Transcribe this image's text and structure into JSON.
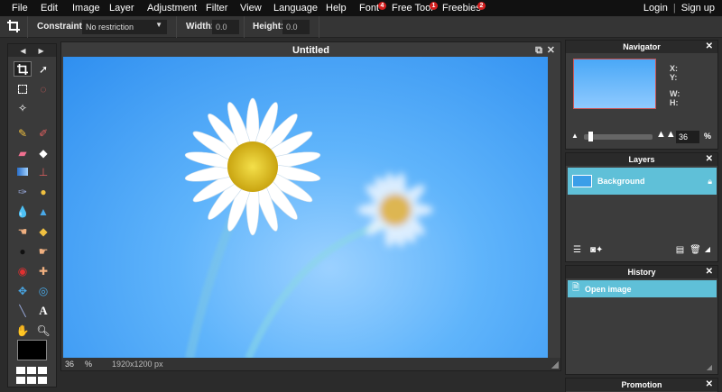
{
  "menubar": {
    "items": [
      "File",
      "Edit",
      "Image",
      "Layer",
      "Adjustment",
      "Filter",
      "View",
      "Language",
      "Help"
    ],
    "font_label": "Font",
    "font_badge": "4",
    "freetool_label": "Free Tool",
    "freetool_badge": "1",
    "freebies_label": "Freebies",
    "freebies_badge": "2",
    "login": "Login",
    "separator": "|",
    "signup": "Sign up"
  },
  "options": {
    "constraint_label": "Constraint:",
    "constraint_value": "No restriction",
    "width_label": "Width:",
    "width_value": "0.0",
    "height_label": "Height:",
    "height_value": "0.0"
  },
  "canvas": {
    "title": "Untitled",
    "zoom": "36",
    "zoom_unit": "%",
    "dimensions": "1920x1200 px"
  },
  "navigator": {
    "title": "Navigator",
    "x_label": "X:",
    "y_label": "Y:",
    "w_label": "W:",
    "h_label": "H:",
    "zoom": "36",
    "zoom_unit": "%"
  },
  "layers": {
    "title": "Layers",
    "layer_name": "Background"
  },
  "history": {
    "title": "History",
    "entry": "Open image"
  },
  "promotion": {
    "title": "Promotion"
  },
  "colors": {
    "accent": "#5fc0d8",
    "badge": "#d31f1f",
    "menubar_bg": "#111111"
  }
}
